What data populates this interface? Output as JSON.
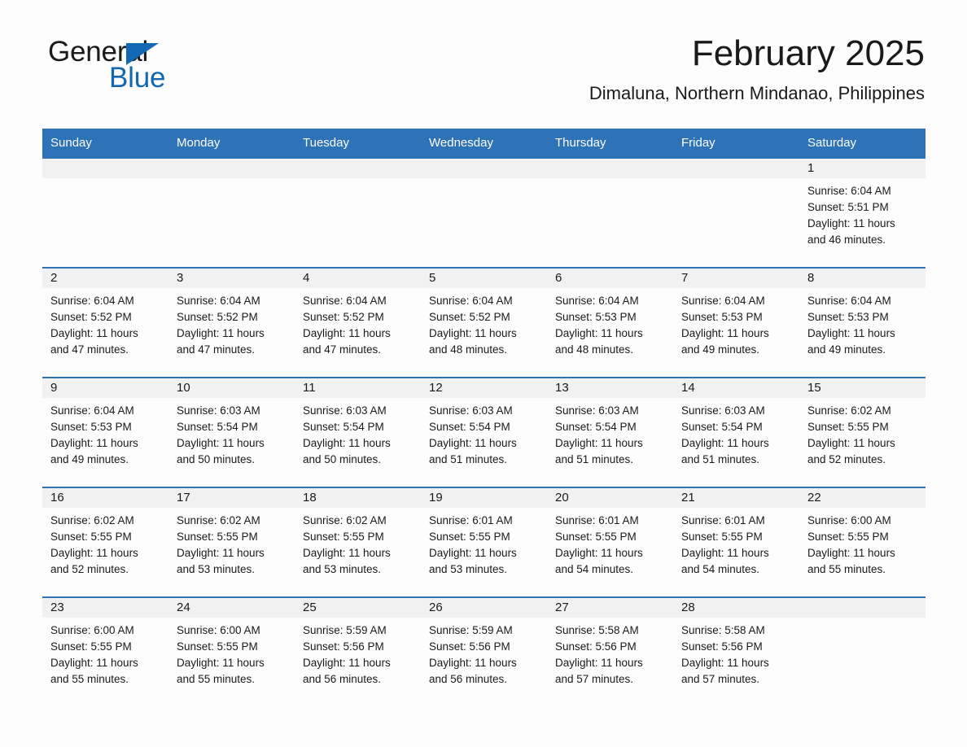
{
  "brand": {
    "name_part1": "General",
    "name_part2": "Blue",
    "triangle_color": "#1268b3"
  },
  "header": {
    "month_title": "February 2025",
    "location": "Dimaluna, Northern Mindanao, Philippines",
    "accent_color": "#2e72b8"
  },
  "weekday_headers": [
    "Sunday",
    "Monday",
    "Tuesday",
    "Wednesday",
    "Thursday",
    "Friday",
    "Saturday"
  ],
  "weeks": [
    [
      {
        "day": "",
        "sunrise": "",
        "sunset": "",
        "daylight_line1": "",
        "daylight_line2": ""
      },
      {
        "day": "",
        "sunrise": "",
        "sunset": "",
        "daylight_line1": "",
        "daylight_line2": ""
      },
      {
        "day": "",
        "sunrise": "",
        "sunset": "",
        "daylight_line1": "",
        "daylight_line2": ""
      },
      {
        "day": "",
        "sunrise": "",
        "sunset": "",
        "daylight_line1": "",
        "daylight_line2": ""
      },
      {
        "day": "",
        "sunrise": "",
        "sunset": "",
        "daylight_line1": "",
        "daylight_line2": ""
      },
      {
        "day": "",
        "sunrise": "",
        "sunset": "",
        "daylight_line1": "",
        "daylight_line2": ""
      },
      {
        "day": "1",
        "sunrise": "Sunrise: 6:04 AM",
        "sunset": "Sunset: 5:51 PM",
        "daylight_line1": "Daylight: 11 hours",
        "daylight_line2": "and 46 minutes."
      }
    ],
    [
      {
        "day": "2",
        "sunrise": "Sunrise: 6:04 AM",
        "sunset": "Sunset: 5:52 PM",
        "daylight_line1": "Daylight: 11 hours",
        "daylight_line2": "and 47 minutes."
      },
      {
        "day": "3",
        "sunrise": "Sunrise: 6:04 AM",
        "sunset": "Sunset: 5:52 PM",
        "daylight_line1": "Daylight: 11 hours",
        "daylight_line2": "and 47 minutes."
      },
      {
        "day": "4",
        "sunrise": "Sunrise: 6:04 AM",
        "sunset": "Sunset: 5:52 PM",
        "daylight_line1": "Daylight: 11 hours",
        "daylight_line2": "and 47 minutes."
      },
      {
        "day": "5",
        "sunrise": "Sunrise: 6:04 AM",
        "sunset": "Sunset: 5:52 PM",
        "daylight_line1": "Daylight: 11 hours",
        "daylight_line2": "and 48 minutes."
      },
      {
        "day": "6",
        "sunrise": "Sunrise: 6:04 AM",
        "sunset": "Sunset: 5:53 PM",
        "daylight_line1": "Daylight: 11 hours",
        "daylight_line2": "and 48 minutes."
      },
      {
        "day": "7",
        "sunrise": "Sunrise: 6:04 AM",
        "sunset": "Sunset: 5:53 PM",
        "daylight_line1": "Daylight: 11 hours",
        "daylight_line2": "and 49 minutes."
      },
      {
        "day": "8",
        "sunrise": "Sunrise: 6:04 AM",
        "sunset": "Sunset: 5:53 PM",
        "daylight_line1": "Daylight: 11 hours",
        "daylight_line2": "and 49 minutes."
      }
    ],
    [
      {
        "day": "9",
        "sunrise": "Sunrise: 6:04 AM",
        "sunset": "Sunset: 5:53 PM",
        "daylight_line1": "Daylight: 11 hours",
        "daylight_line2": "and 49 minutes."
      },
      {
        "day": "10",
        "sunrise": "Sunrise: 6:03 AM",
        "sunset": "Sunset: 5:54 PM",
        "daylight_line1": "Daylight: 11 hours",
        "daylight_line2": "and 50 minutes."
      },
      {
        "day": "11",
        "sunrise": "Sunrise: 6:03 AM",
        "sunset": "Sunset: 5:54 PM",
        "daylight_line1": "Daylight: 11 hours",
        "daylight_line2": "and 50 minutes."
      },
      {
        "day": "12",
        "sunrise": "Sunrise: 6:03 AM",
        "sunset": "Sunset: 5:54 PM",
        "daylight_line1": "Daylight: 11 hours",
        "daylight_line2": "and 51 minutes."
      },
      {
        "day": "13",
        "sunrise": "Sunrise: 6:03 AM",
        "sunset": "Sunset: 5:54 PM",
        "daylight_line1": "Daylight: 11 hours",
        "daylight_line2": "and 51 minutes."
      },
      {
        "day": "14",
        "sunrise": "Sunrise: 6:03 AM",
        "sunset": "Sunset: 5:54 PM",
        "daylight_line1": "Daylight: 11 hours",
        "daylight_line2": "and 51 minutes."
      },
      {
        "day": "15",
        "sunrise": "Sunrise: 6:02 AM",
        "sunset": "Sunset: 5:55 PM",
        "daylight_line1": "Daylight: 11 hours",
        "daylight_line2": "and 52 minutes."
      }
    ],
    [
      {
        "day": "16",
        "sunrise": "Sunrise: 6:02 AM",
        "sunset": "Sunset: 5:55 PM",
        "daylight_line1": "Daylight: 11 hours",
        "daylight_line2": "and 52 minutes."
      },
      {
        "day": "17",
        "sunrise": "Sunrise: 6:02 AM",
        "sunset": "Sunset: 5:55 PM",
        "daylight_line1": "Daylight: 11 hours",
        "daylight_line2": "and 53 minutes."
      },
      {
        "day": "18",
        "sunrise": "Sunrise: 6:02 AM",
        "sunset": "Sunset: 5:55 PM",
        "daylight_line1": "Daylight: 11 hours",
        "daylight_line2": "and 53 minutes."
      },
      {
        "day": "19",
        "sunrise": "Sunrise: 6:01 AM",
        "sunset": "Sunset: 5:55 PM",
        "daylight_line1": "Daylight: 11 hours",
        "daylight_line2": "and 53 minutes."
      },
      {
        "day": "20",
        "sunrise": "Sunrise: 6:01 AM",
        "sunset": "Sunset: 5:55 PM",
        "daylight_line1": "Daylight: 11 hours",
        "daylight_line2": "and 54 minutes."
      },
      {
        "day": "21",
        "sunrise": "Sunrise: 6:01 AM",
        "sunset": "Sunset: 5:55 PM",
        "daylight_line1": "Daylight: 11 hours",
        "daylight_line2": "and 54 minutes."
      },
      {
        "day": "22",
        "sunrise": "Sunrise: 6:00 AM",
        "sunset": "Sunset: 5:55 PM",
        "daylight_line1": "Daylight: 11 hours",
        "daylight_line2": "and 55 minutes."
      }
    ],
    [
      {
        "day": "23",
        "sunrise": "Sunrise: 6:00 AM",
        "sunset": "Sunset: 5:55 PM",
        "daylight_line1": "Daylight: 11 hours",
        "daylight_line2": "and 55 minutes."
      },
      {
        "day": "24",
        "sunrise": "Sunrise: 6:00 AM",
        "sunset": "Sunset: 5:55 PM",
        "daylight_line1": "Daylight: 11 hours",
        "daylight_line2": "and 55 minutes."
      },
      {
        "day": "25",
        "sunrise": "Sunrise: 5:59 AM",
        "sunset": "Sunset: 5:56 PM",
        "daylight_line1": "Daylight: 11 hours",
        "daylight_line2": "and 56 minutes."
      },
      {
        "day": "26",
        "sunrise": "Sunrise: 5:59 AM",
        "sunset": "Sunset: 5:56 PM",
        "daylight_line1": "Daylight: 11 hours",
        "daylight_line2": "and 56 minutes."
      },
      {
        "day": "27",
        "sunrise": "Sunrise: 5:58 AM",
        "sunset": "Sunset: 5:56 PM",
        "daylight_line1": "Daylight: 11 hours",
        "daylight_line2": "and 57 minutes."
      },
      {
        "day": "28",
        "sunrise": "Sunrise: 5:58 AM",
        "sunset": "Sunset: 5:56 PM",
        "daylight_line1": "Daylight: 11 hours",
        "daylight_line2": "and 57 minutes."
      },
      {
        "day": "",
        "sunrise": "",
        "sunset": "",
        "daylight_line1": "",
        "daylight_line2": ""
      }
    ]
  ]
}
